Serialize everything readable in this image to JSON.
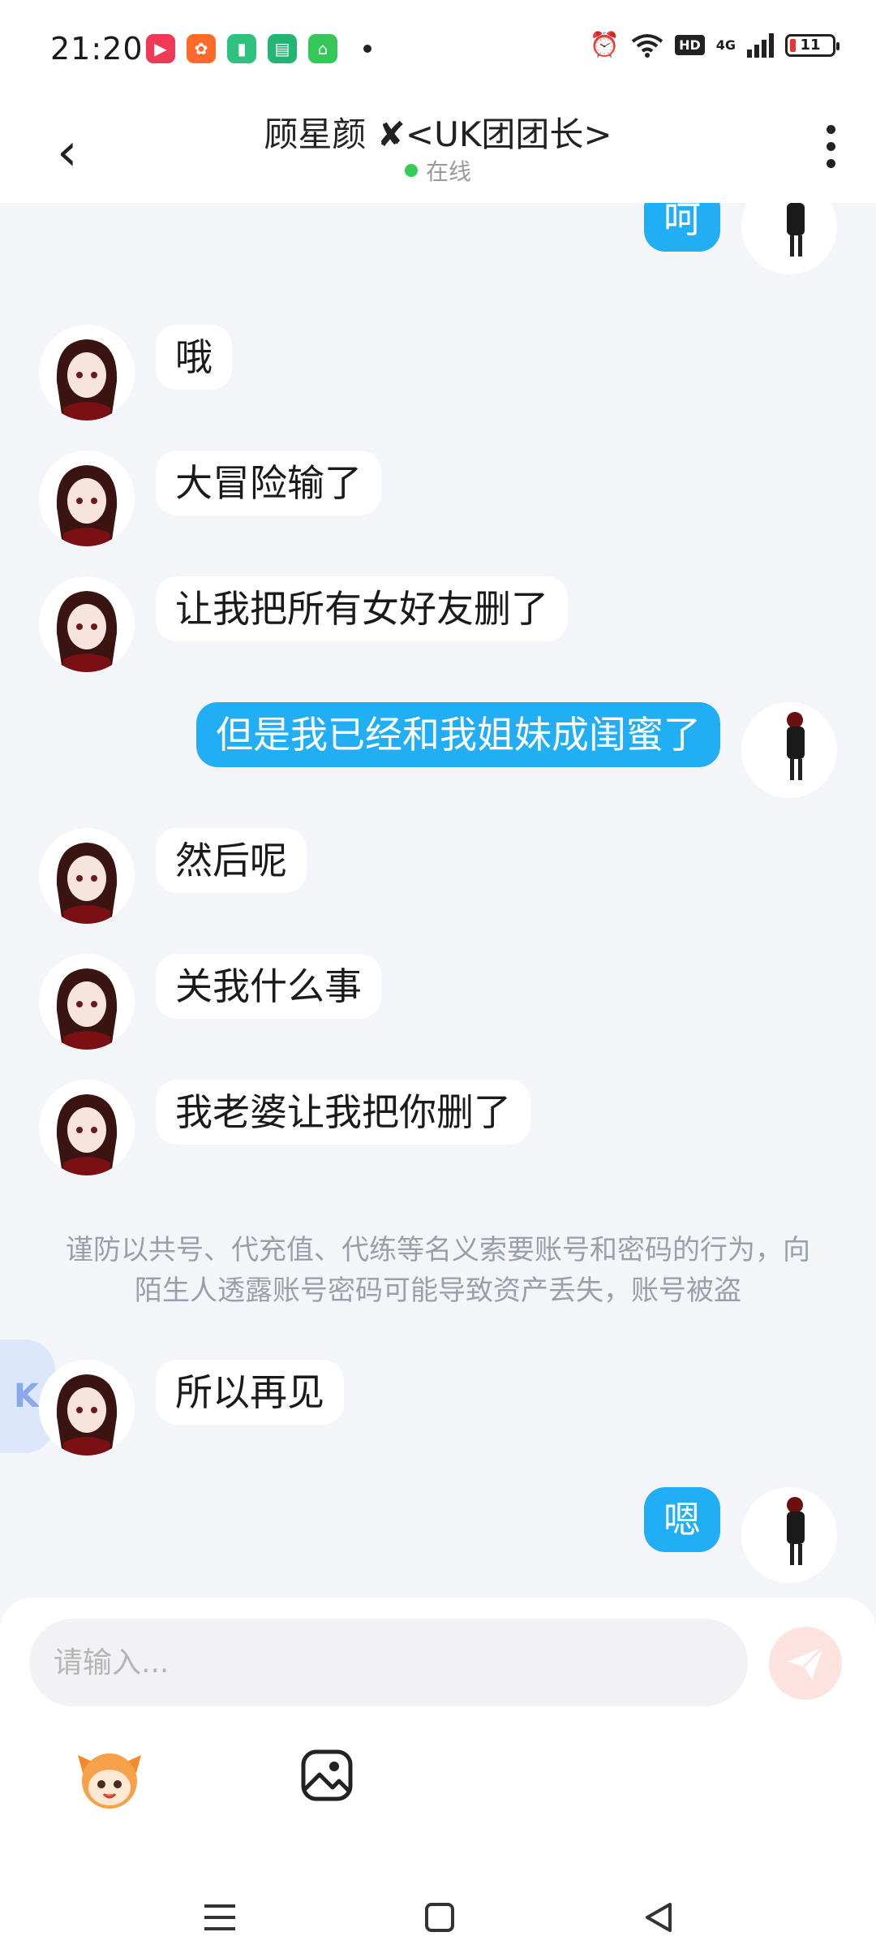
{
  "status_bar": {
    "time": "21:20",
    "network": "4G",
    "hd_label": "HD",
    "battery": "11",
    "notification_icons": [
      {
        "name": "video-app-icon",
        "color": "#ee3a57",
        "glyph": "▶"
      },
      {
        "name": "orange-app-icon",
        "color": "#ff6a2b",
        "glyph": "✿"
      },
      {
        "name": "battery-app-icon",
        "color": "#2ec27e",
        "glyph": "▮"
      },
      {
        "name": "message-app-icon",
        "color": "#22b573",
        "glyph": "▤"
      },
      {
        "name": "shop-app-icon",
        "color": "#34c759",
        "glyph": "⌂"
      }
    ]
  },
  "header": {
    "title": "顾星颜 ✘<UK团团长>",
    "presence": "在线"
  },
  "messages": [
    {
      "dir": "out",
      "text": "呵"
    },
    {
      "dir": "in",
      "text": "哦"
    },
    {
      "dir": "in",
      "text": "大冒险输了"
    },
    {
      "dir": "in",
      "text": "让我把所有女好友删了"
    },
    {
      "dir": "out",
      "text": "但是我已经和我姐妹成闺蜜了"
    },
    {
      "dir": "in",
      "text": "然后呢"
    },
    {
      "dir": "in",
      "text": "关我什么事"
    },
    {
      "dir": "in",
      "text": "我老婆让我把你删了"
    },
    {
      "dir": "in",
      "text": "所以再见"
    },
    {
      "dir": "out",
      "text": "嗯"
    }
  ],
  "notice": "谨防以共号、代充值、代练等名义索要账号和密码的行为，向陌生人透露账号密码可能导致资产丢失，账号被盗",
  "floating_badge": "K",
  "input": {
    "placeholder": "请输入..."
  },
  "colors": {
    "outgoing_bubble": "#21aef5",
    "incoming_bubble": "#ffffff",
    "background": "#f4f5f8",
    "online_dot": "#33cc55"
  }
}
